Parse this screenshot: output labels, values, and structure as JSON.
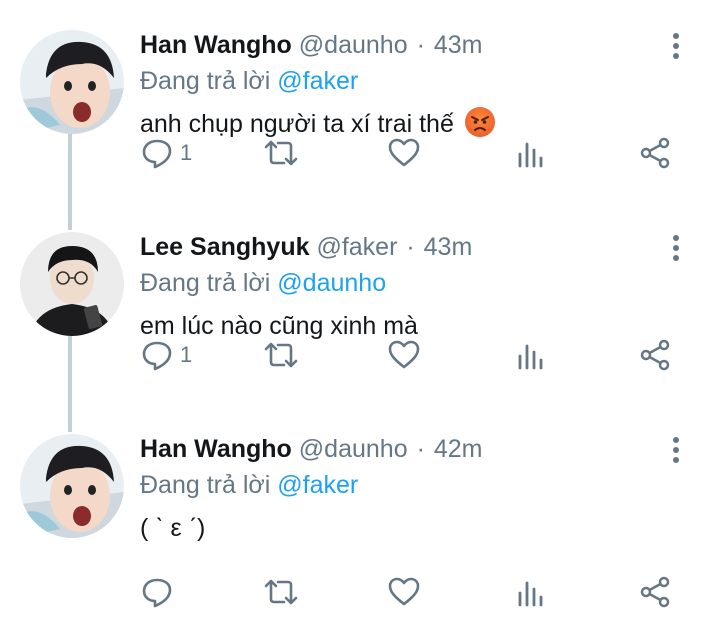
{
  "tweets": [
    {
      "name": "Han Wangho",
      "handle": "@daunho",
      "time": "43m",
      "reply_prefix": "Đang trả lời",
      "reply_to": "@faker",
      "text": "anh chụp người ta xí trai thế",
      "emoji": "😡",
      "reply_count": "1",
      "avatar": "boy-surprised-avatar"
    },
    {
      "name": "Lee Sanghyuk",
      "handle": "@faker",
      "time": "43m",
      "reply_prefix": "Đang trả lời",
      "reply_to": "@daunho",
      "text": "em lúc nào cũng xinh mà",
      "reply_count": "1",
      "avatar": "man-glasses-phone-avatar"
    },
    {
      "name": "Han Wangho",
      "handle": "@daunho",
      "time": "42m",
      "reply_prefix": "Đang trả lời",
      "reply_to": "@faker",
      "text": "( ˋ ε ˊ)",
      "reply_count": "",
      "avatar": "boy-surprised-avatar"
    }
  ],
  "colors": {
    "accent": "#1da1f2",
    "muted": "#657786",
    "text": "#14171a",
    "thread_line": "#c4cfd6"
  },
  "icons": [
    "more-vertical-icon",
    "reply-icon",
    "retweet-icon",
    "like-icon",
    "analytics-icon",
    "share-icon"
  ]
}
